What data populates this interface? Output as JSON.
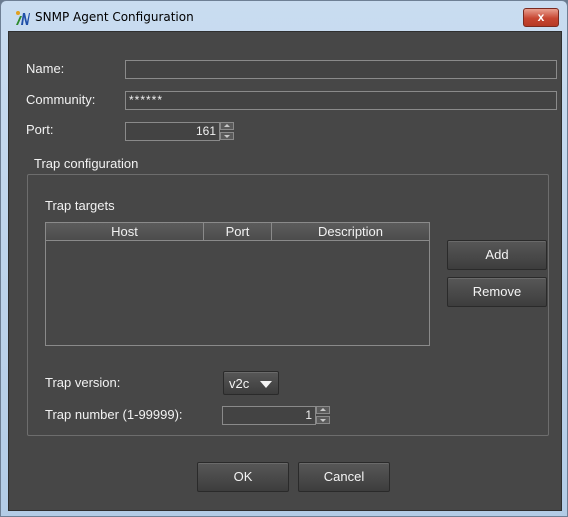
{
  "window": {
    "title": "SNMP Agent Configuration",
    "close_glyph": "x"
  },
  "form": {
    "name_label": "Name:",
    "name_value": "",
    "community_label": "Community:",
    "community_value": "******",
    "port_label": "Port:",
    "port_value": "161"
  },
  "trap": {
    "group_title": "Trap configuration",
    "targets_label": "Trap targets",
    "columns": [
      "Host",
      "Port",
      "Description"
    ],
    "rows": [],
    "add_label": "Add",
    "remove_label": "Remove",
    "version_label": "Trap version:",
    "version_value": "v2c",
    "number_label": "Trap number (1-99999):",
    "number_value": "1"
  },
  "footer": {
    "ok_label": "OK",
    "cancel_label": "Cancel"
  },
  "colors": {
    "panel": "#474747",
    "field_border": "#8a8a8a",
    "text": "#f2f2f2",
    "titlebar": "#c9dcf0",
    "close": "#c74632"
  },
  "icons": {
    "app": "app-logo-icon",
    "close": "close-icon",
    "spin_up": "spin-up-icon",
    "spin_down": "spin-down-icon",
    "dropdown": "chevron-down-icon"
  }
}
